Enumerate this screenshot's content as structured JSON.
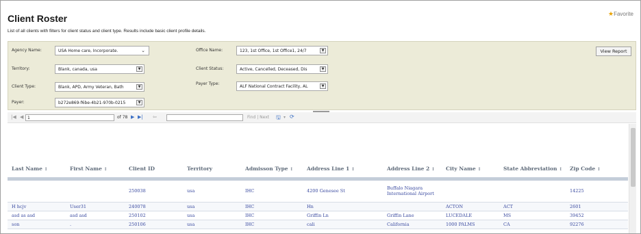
{
  "header": {
    "title": "Client Roster",
    "favorite": "Favorite",
    "subtitle": "List of all clients with filters for client status and client type. Results include basic client profile details."
  },
  "filters": {
    "agency_label": "Agency Name:",
    "agency_value": "USA Home care, Incorporate.",
    "territory_label": "Territory:",
    "territory_value": "Blank, canada, usa",
    "client_type_label": "Client Type:",
    "client_type_value": "Blank, APD, Army Veteran, Bath",
    "payer_label": "Payer:",
    "payer_value": "b272e869-f6be-4b21-970b-0215",
    "office_label": "Office Name:",
    "office_value": "123, 1st Office, 1st Office1, 24/7",
    "client_status_label": "Client Status:",
    "client_status_value": "Active, Cancelled, Deceased, Dis",
    "payer_type_label": "Payer Type:",
    "payer_type_value": "ALF National Contract Facility, AL",
    "view_report": "View Report"
  },
  "toolbar": {
    "page_value": "1",
    "of_pages": "of 78",
    "find_next": "Find | Next"
  },
  "table": {
    "columns": [
      "Last Name",
      "First Name",
      "Client ID",
      "Territory",
      "Admisson Type",
      "Address Line 1",
      "Address Line 2",
      "City Name",
      "State Abbreviation",
      "Zip Code"
    ],
    "sort_glyph": "↕",
    "rows": [
      [
        "",
        "",
        "250038",
        "usa",
        "IHC",
        "4200 Genesee St",
        "Buffalo Niagara International Airport",
        "",
        "",
        "14225"
      ],
      [
        "H hcjv",
        "User31",
        "240078",
        "usa",
        "IHC",
        "Hn",
        "",
        "ACTON",
        "ACT",
        "2601"
      ],
      [
        "asd as asd",
        "asd asd",
        "250102",
        "usa",
        "IHC",
        "Griffin Ln",
        "Griffin Lane",
        "LUCEDALE",
        "MS",
        "39452"
      ],
      [
        "son",
        ".",
        "250106",
        "usa",
        "IHC",
        "cali",
        "California",
        "1000 PALMS",
        "CA",
        "92276"
      ]
    ]
  }
}
